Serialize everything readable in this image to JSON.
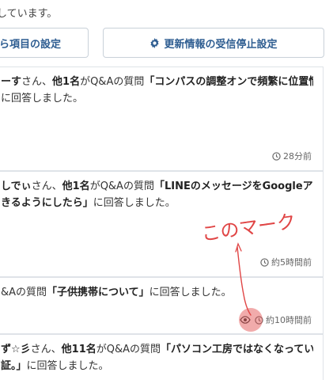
{
  "intro": {
    "text": "しています。"
  },
  "buttons": {
    "settings_label": "ら項目の設定",
    "unsubscribe_label": "更新情報の受信停止設定"
  },
  "icons": {
    "gear": "gear-icon",
    "clock": "clock-icon",
    "eye": "eye-icon"
  },
  "colors": {
    "accent": "#2e5d91",
    "annotation": "#e04545"
  },
  "feed": [
    {
      "user": "ーす",
      "after_user": "さん、",
      "others": "他1名",
      "mid": "がQ&Aの質問",
      "question_open": "「コンパスの調整オンで頻繁に位置情報の",
      "line2_bold": "",
      "line2_rest": "に回答しました。",
      "time": "28分前"
    },
    {
      "user": "しでぃ",
      "after_user": "さん、",
      "others": "他1名",
      "mid": "がQ&Aの質問",
      "question_open": "「LINEのメッセージをGoogleアシスタ",
      "line2_bold": "きるようにしたら」",
      "line2_rest": "に回答しました。",
      "time": "約5時間前"
    },
    {
      "prefix": "&Aの質問",
      "question": "「子供携帯について」",
      "rest": "に回答しました。",
      "time": "約10時間前"
    },
    {
      "user": "ず☆彡",
      "after_user": "さん、",
      "others": "他11名",
      "mid": "がQ&Aの質問",
      "question_open": "「パソコン工房ではなくなっていた、",
      "line2_bold": "証。」",
      "line2_rest": "に回答しました。"
    }
  ],
  "annotation": {
    "text": "このマーク"
  }
}
